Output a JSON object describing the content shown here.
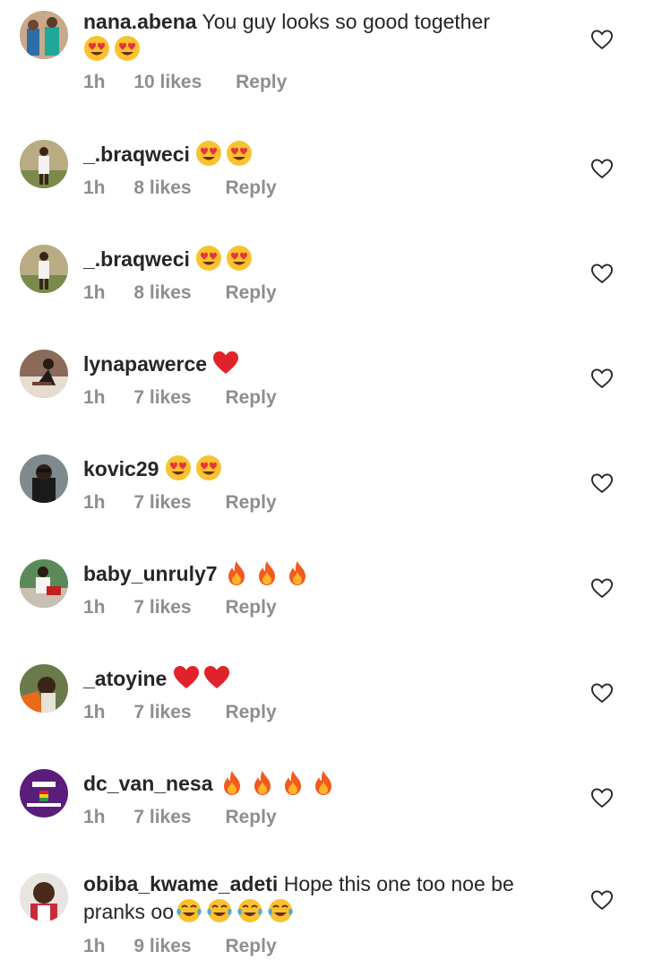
{
  "comments": [
    {
      "username": "nana.abena",
      "text": "You guy looks so good together",
      "emojis": [
        "heart-eyes",
        "heart-eyes"
      ],
      "time": "1h",
      "likes": "10 likes",
      "reply": "Reply"
    },
    {
      "username": "_.braqweci",
      "text": "",
      "emojis": [
        "heart-eyes",
        "heart-eyes"
      ],
      "time": "1h",
      "likes": "8 likes",
      "reply": "Reply"
    },
    {
      "username": "_.braqweci",
      "text": "",
      "emojis": [
        "heart-eyes",
        "heart-eyes"
      ],
      "time": "1h",
      "likes": "8 likes",
      "reply": "Reply"
    },
    {
      "username": "lynapawerce",
      "text": "",
      "emojis": [
        "red-heart"
      ],
      "time": "1h",
      "likes": "7 likes",
      "reply": "Reply"
    },
    {
      "username": "kovic29",
      "text": "",
      "emojis": [
        "heart-eyes",
        "heart-eyes"
      ],
      "time": "1h",
      "likes": "7 likes",
      "reply": "Reply"
    },
    {
      "username": "baby_unruly7",
      "text": "",
      "emojis": [
        "fire",
        "fire",
        "fire"
      ],
      "time": "1h",
      "likes": "7 likes",
      "reply": "Reply"
    },
    {
      "username": "_atoyine",
      "text": "",
      "emojis": [
        "red-heart",
        "red-heart"
      ],
      "time": "1h",
      "likes": "7 likes",
      "reply": "Reply"
    },
    {
      "username": "dc_van_nesa",
      "text": "",
      "emojis": [
        "fire",
        "fire",
        "fire",
        "fire"
      ],
      "time": "1h",
      "likes": "7 likes",
      "reply": "Reply"
    },
    {
      "username": "obiba_kwame_adeti",
      "text": "Hope this one too noe be pranks oo",
      "emojis": [
        "tears-of-joy",
        "tears-of-joy",
        "tears-of-joy",
        "tears-of-joy"
      ],
      "time": "1h",
      "likes": "9 likes",
      "reply": "Reply"
    }
  ]
}
